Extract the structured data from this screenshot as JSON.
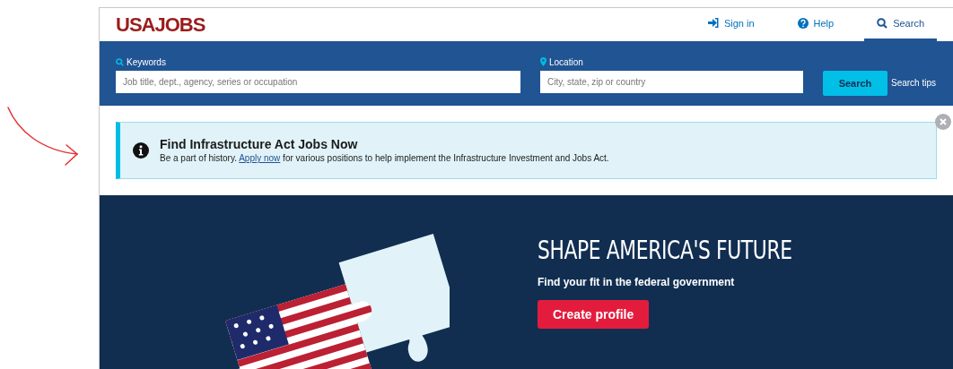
{
  "header": {
    "logo": "USAJOBS",
    "nav": [
      {
        "label": "Sign in",
        "selected": false
      },
      {
        "label": "Help",
        "selected": false
      },
      {
        "label": "Search",
        "selected": true
      }
    ]
  },
  "search": {
    "fields": [
      {
        "label": "Keywords",
        "placeholder": "Job title, dept., agency, series or occupation"
      },
      {
        "label": "Location",
        "placeholder": "City, state, zip or country"
      }
    ],
    "button": "Search",
    "tips": "Search tips"
  },
  "alert": {
    "title": "Find Infrastructure Act Jobs Now",
    "text": "Be a part of history. ",
    "link": "Apply now",
    "text_after": " for various positions to help implement the Infrastructure Investment and Jobs Act."
  },
  "hero": {
    "title": "SHAPE AMERICA'S FUTURE",
    "subtitle": "Find your fit in the federal government",
    "button": "Create profile"
  }
}
